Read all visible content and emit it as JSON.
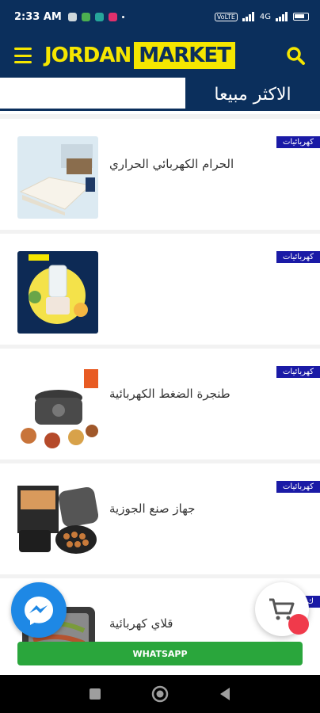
{
  "status": {
    "time": "2:33 AM",
    "signal_label": "4G",
    "volte_label": "VoLTE"
  },
  "header": {
    "logo_part1": "JORDAN",
    "logo_part2": "MARKET"
  },
  "section": {
    "title": "الاكثر مبيعا"
  },
  "products": [
    {
      "category": "كهربائيات",
      "name": "الحرام الكهربائي الحراري",
      "image": "electric-blanket"
    },
    {
      "category": "كهربائيات",
      "name": "",
      "image": "blender"
    },
    {
      "category": "كهربائيات",
      "name": "طنجرة الضغط الكهربائية",
      "image": "pressure-cooker"
    },
    {
      "category": "كهربائيات",
      "name": "جهاز صنع الجوزية",
      "image": "walnut-cake-maker"
    },
    {
      "category": "ك",
      "name": "قلاي كهربائية",
      "image": "electric-grill"
    }
  ],
  "floating": {
    "whatsapp_label": "WHATSAPP",
    "messenger_icon": "messenger-icon",
    "cart_icon": "cart-icon"
  },
  "colors": {
    "brand_navy": "#0b2f5c",
    "brand_yellow": "#f5e600",
    "badge_blue": "#1a1aa6",
    "whatsapp_green": "#2aa63c"
  }
}
